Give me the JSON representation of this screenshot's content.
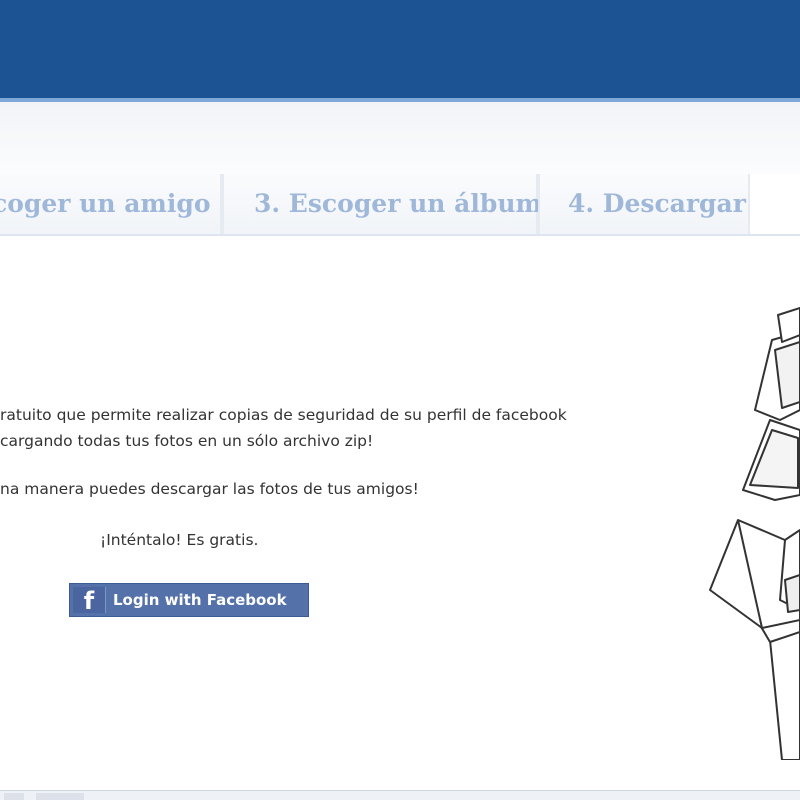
{
  "steps": {
    "tab2": "coger un amigo",
    "tab3": "3. Escoger un álbum",
    "tab4": "4. Descargar"
  },
  "content": {
    "line1": "ratuito que permite realizar copias de seguridad de su perfil de facebook",
    "line2": "cargando todas tus fotos en un sólo archivo zip!",
    "line3": "na manera puedes descargar las fotos de tus amigos!",
    "try_it": "¡Inténtalo! Es gratis."
  },
  "login": {
    "icon": "facebook-f-icon",
    "label": "Login with Facebook"
  },
  "colors": {
    "brand_blue": "#1c5393",
    "step_text": "#9fb8d9",
    "fb_button": "#5471a9"
  }
}
